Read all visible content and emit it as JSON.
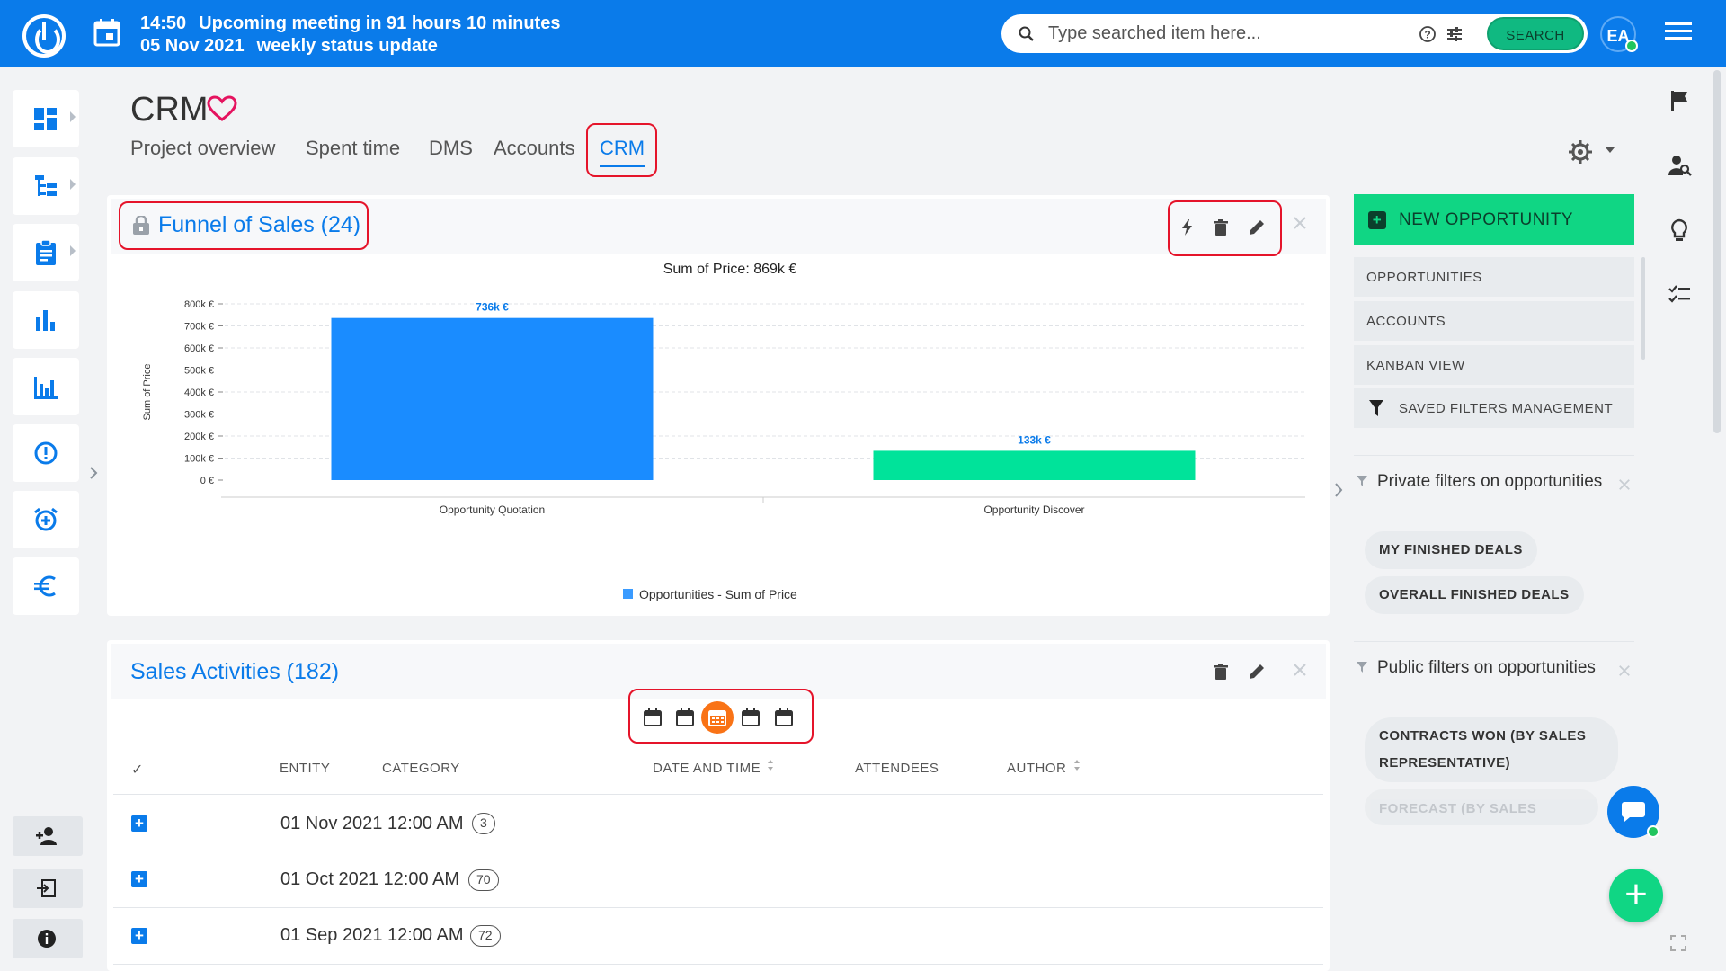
{
  "topbar": {
    "time": "14:50",
    "meeting_label": "Upcoming meeting in 91 hours 10 minutes",
    "date": "05 Nov 2021",
    "meeting_title": "weekly status update",
    "search_placeholder": "Type searched item here...",
    "search_button": "SEARCH",
    "avatar_initials": "EA",
    "brand_color": "#0a7bea"
  },
  "sidebar": {
    "items": [
      "dashboard-icon",
      "tree-icon",
      "clipboard-icon",
      "bar-chart-icon",
      "analytics-icon",
      "alert-icon",
      "alarm-icon",
      "euro-icon"
    ],
    "bottom": [
      "add-user-icon",
      "logout-icon",
      "info-icon"
    ]
  },
  "header": {
    "title": "CRM",
    "tabs": [
      {
        "label": "Project overview"
      },
      {
        "label": "Spent time"
      },
      {
        "label": "DMS"
      },
      {
        "label": "Accounts"
      },
      {
        "label": "CRM",
        "active": true
      }
    ]
  },
  "funnel": {
    "title": "Funnel of Sales (24)"
  },
  "chart_data": {
    "type": "bar",
    "title": "Sum of Price: 869k €",
    "ylabel": "Sum of Price",
    "xlabel": "",
    "categories": [
      "Opportunity Quotation",
      "Opportunity Discover"
    ],
    "series": [
      {
        "name": "Opportunities - Sum of Price",
        "values": [
          736,
          133
        ]
      }
    ],
    "data_labels": [
      "736k €",
      "133k €"
    ],
    "bar_colors": [
      "#1a8cff",
      "#00e39a"
    ],
    "yticks": [
      "0 €",
      "100k €",
      "200k €",
      "300k €",
      "400k €",
      "500k €",
      "600k €",
      "700k €",
      "800k €"
    ],
    "ylim": [
      0,
      800
    ],
    "grid": true,
    "legend": "bottom"
  },
  "activities": {
    "title": "Sales Activities (182)",
    "columns": [
      "ENTITY",
      "CATEGORY",
      "DATE AND TIME",
      "ATTENDEES",
      "AUTHOR"
    ],
    "check_mark": "✓",
    "rows": [
      {
        "date": "01 Nov 2021 12:00 AM",
        "count": "3"
      },
      {
        "date": "01 Oct 2021 12:00 AM",
        "count": "70"
      },
      {
        "date": "01 Sep 2021 12:00 AM",
        "count": "72"
      }
    ]
  },
  "right_panel": {
    "new_opportunity": "NEW OPPORTUNITY",
    "menu": [
      "OPPORTUNITIES",
      "ACCOUNTS",
      "KANBAN VIEW",
      "SAVED FILTERS MANAGEMENT"
    ],
    "private_filters_title": "Private filters on opportunities",
    "private_filters": [
      "MY FINISHED DEALS",
      "OVERALL FINISHED DEALS"
    ],
    "public_filters_title": "Public filters on opportunities",
    "public_filters": [
      "CONTRACTS WON (BY SALES REPRESENTATIVE)",
      "FORECAST (BY SALES"
    ]
  }
}
